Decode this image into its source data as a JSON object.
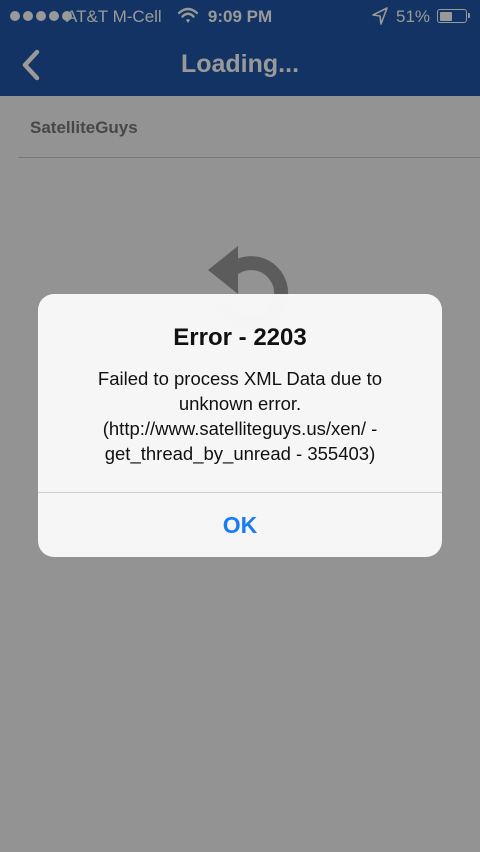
{
  "status_bar": {
    "carrier": "AT&T M-Cell",
    "time": "9:09 PM",
    "battery_percent": "51%",
    "battery_level": 0.51,
    "signal_dots": 5,
    "icons": [
      "signal-dots-icon",
      "wifi-icon",
      "location-arrow-icon",
      "battery-icon"
    ]
  },
  "nav": {
    "title": "Loading...",
    "back_icon": "chevron-left-icon"
  },
  "content": {
    "breadcrumb": "SatelliteGuys",
    "placeholder_icon": "refresh-icon"
  },
  "alert": {
    "title": "Error - 2203",
    "message_lines": [
      "Failed to process XML Data due to",
      "unknown error.",
      "(http://www.satelliteguys.us/xen/ -",
      "get_thread_by_unread - 355403)"
    ],
    "ok_label": "OK"
  },
  "colors": {
    "brand_blue": "#1f55a6",
    "action_blue": "#1a7cf5",
    "overlay": "rgba(0,0,0,0.4)"
  }
}
